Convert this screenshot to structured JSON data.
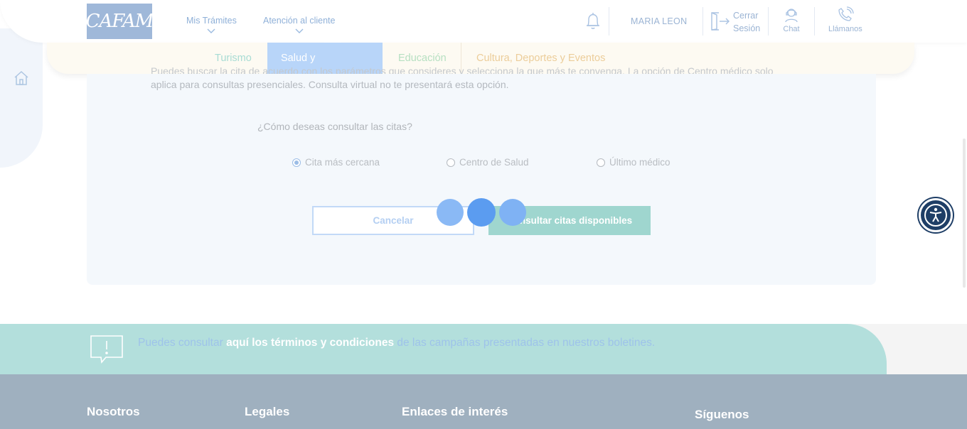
{
  "header": {
    "logo_text": "CAFAM",
    "nav": [
      {
        "label": "Mis Trámites"
      },
      {
        "label": "Atención al cliente"
      }
    ],
    "user_name": "MARIA LEON",
    "logout_line1": "Cerrar",
    "logout_line2": "Sesión",
    "chat_label": "Chat",
    "call_label": "Llámanos"
  },
  "tabs": [
    {
      "label": "Turismo",
      "color": "#a8dcd4"
    },
    {
      "label": "Salud y Droguerías",
      "active": true
    },
    {
      "label": "Educación",
      "color": "#b7e0c2"
    },
    {
      "label": "Cultura, Deportes y Eventos",
      "color": "#eccd9a"
    }
  ],
  "main": {
    "intro_text_line1": "Puedes buscar la cita de acuerdo con los parámetros que consideres y selecciona la que más te convenga. La opción de Centro médico solo",
    "intro_text_line2": "aplica para consultas presenciales. Consulta virtual no te presentará esta opción.",
    "question": "¿Cómo deseas consultar las citas?",
    "options": [
      {
        "label": "Cita más cercana",
        "checked": true
      },
      {
        "label": "Centro de Salud",
        "checked": false
      },
      {
        "label": "Último médico",
        "checked": false
      }
    ],
    "cancel_label": "Cancelar",
    "consult_label": "Consultar citas disponibles"
  },
  "banner": {
    "pre": "Puedes consultar ",
    "link": "aquí los términos y condiciones",
    "post": " de las campañas presentadas en nuestros boletines."
  },
  "footer": {
    "col1": "Nosotros",
    "col2": "Legales",
    "col3": "Enlaces de interés",
    "col4": "Síguenos"
  },
  "colors": {
    "accent_blue": "#b8d5f9",
    "loader": "#5b9cf0",
    "accessibility": "#1e3e66"
  },
  "icons": [
    "home-icon",
    "chevron-down-icon",
    "bell-icon",
    "logout-icon",
    "chat-agent-icon",
    "phone-icon",
    "alert-bubble-icon",
    "accessibility-icon"
  ]
}
